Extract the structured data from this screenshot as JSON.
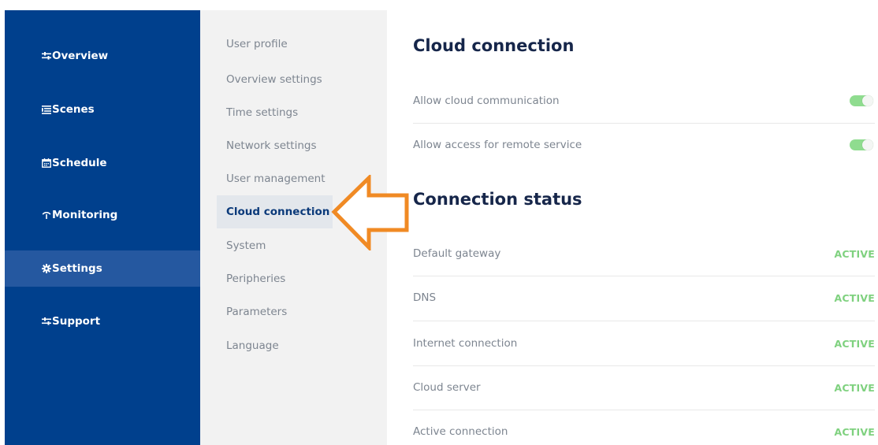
{
  "sidebar": {
    "items": [
      {
        "label": "Overview",
        "icon": "sliders-icon",
        "active": false
      },
      {
        "label": "Scenes",
        "icon": "list-icon",
        "active": false
      },
      {
        "label": "Schedule",
        "icon": "calendar-icon",
        "active": false
      },
      {
        "label": "Monitoring",
        "icon": "signal-icon",
        "active": false
      },
      {
        "label": "Settings",
        "icon": "gear-icon",
        "active": true
      },
      {
        "label": "Support",
        "icon": "sliders-icon",
        "active": false
      }
    ]
  },
  "submenu": {
    "items": [
      {
        "label": "User profile",
        "active": false
      },
      {
        "label": "Overview settings",
        "active": false
      },
      {
        "label": "Time settings",
        "active": false
      },
      {
        "label": "Network settings",
        "active": false
      },
      {
        "label": "User management",
        "active": false
      },
      {
        "label": "Cloud connection",
        "active": true
      },
      {
        "label": "System",
        "active": false
      },
      {
        "label": "Peripheries",
        "active": false
      },
      {
        "label": "Parameters",
        "active": false
      },
      {
        "label": "Language",
        "active": false
      }
    ]
  },
  "cloud": {
    "title": "Cloud connection",
    "settings": [
      {
        "label": "Allow cloud communication",
        "enabled": true
      },
      {
        "label": "Allow access for remote service",
        "enabled": true
      }
    ]
  },
  "status": {
    "title": "Connection status",
    "rows": [
      {
        "label": "Default gateway",
        "value": "ACTIVE"
      },
      {
        "label": "DNS",
        "value": "ACTIVE"
      },
      {
        "label": "Internet connection",
        "value": "ACTIVE"
      },
      {
        "label": "Cloud server",
        "value": "ACTIVE"
      },
      {
        "label": "Active connection",
        "value": "ACTIVE"
      }
    ]
  },
  "colors": {
    "sidebar_bg": "#00408d",
    "sidebar_active": "#2558a0",
    "submenu_bg": "#f2f2f2",
    "accent_arrow": "#f08a24",
    "status_active": "#7fd17f",
    "toggle_on": "#8fdc8f",
    "title_text": "#16264a"
  }
}
